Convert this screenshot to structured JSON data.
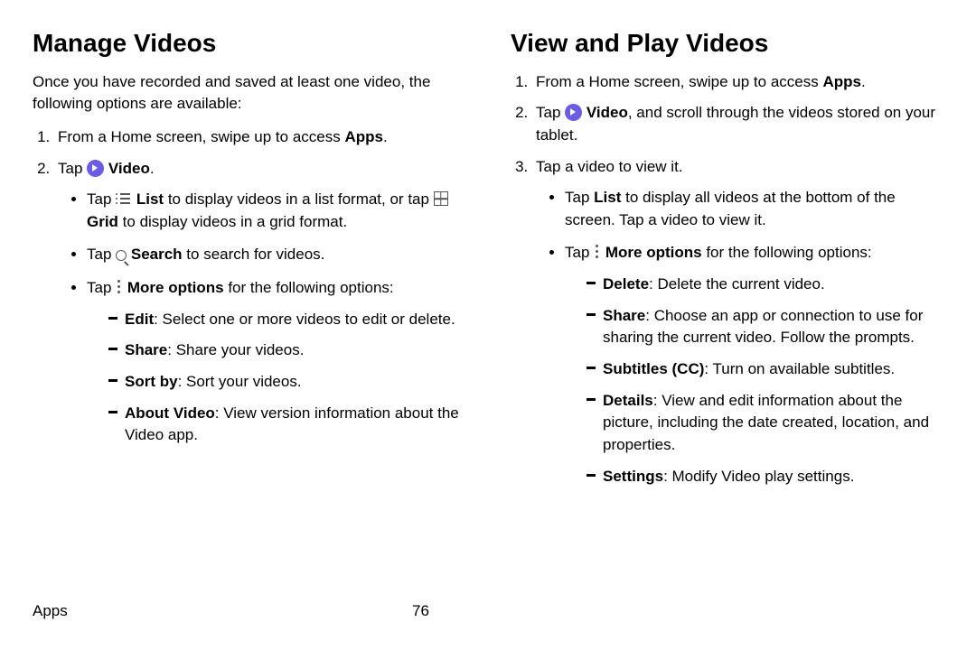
{
  "footer": {
    "section": "Apps",
    "page": "76"
  },
  "left": {
    "heading": "Manage Videos",
    "intro": "Once you have recorded and saved at least one video, the following options are available:",
    "step1_pre": "From a Home screen, swipe up to access ",
    "step1_bold": "Apps",
    "step1_post": ".",
    "step2_pre": "Tap ",
    "step2_bold": " Video",
    "step2_post": ".",
    "b1_pre": "Tap ",
    "b1_listbold": " List",
    "b1_mid": " to display videos in a list format, or tap ",
    "b1_gridbold": " Grid",
    "b1_post": " to display videos in a grid format.",
    "b2_pre": "Tap ",
    "b2_bold": " Search",
    "b2_post": " to search for videos.",
    "b3_pre": "Tap ",
    "b3_bold": " More options",
    "b3_post": " for the following options:",
    "d1_bold": "Edit",
    "d1_text": ": Select one or more videos to edit or delete.",
    "d2_bold": "Share",
    "d2_text": ": Share your videos.",
    "d3_bold": "Sort by",
    "d3_text": ": Sort your videos.",
    "d4_bold": "About Video",
    "d4_text": ": View version information about the Video app."
  },
  "right": {
    "heading": "View and Play Videos",
    "step1_pre": "From a Home screen, swipe up to access ",
    "step1_bold": "Apps",
    "step1_post": ".",
    "step2_pre": "Tap ",
    "step2_bold": " Video",
    "step2_post": ", and scroll through the videos stored on your tablet.",
    "step3": "Tap a video to view it.",
    "b1_pre": "Tap ",
    "b1_bold": "List",
    "b1_post": " to display all videos at the bottom of the screen. Tap a video to view it.",
    "b2_pre": "Tap ",
    "b2_bold": " More options",
    "b2_post": " for the following options:",
    "d1_bold": "Delete",
    "d1_text": ": Delete the current video.",
    "d2_bold": "Share",
    "d2_text": ": Choose an app or connection to use for sharing the current video. Follow the prompts.",
    "d3_bold": "Subtitles (CC)",
    "d3_text": ": Turn on available subtitles.",
    "d4_bold": "Details",
    "d4_text": ": View and edit information about the picture, including the date created, location, and properties.",
    "d5_bold": "Settings",
    "d5_text": ": Modify Video play settings."
  }
}
